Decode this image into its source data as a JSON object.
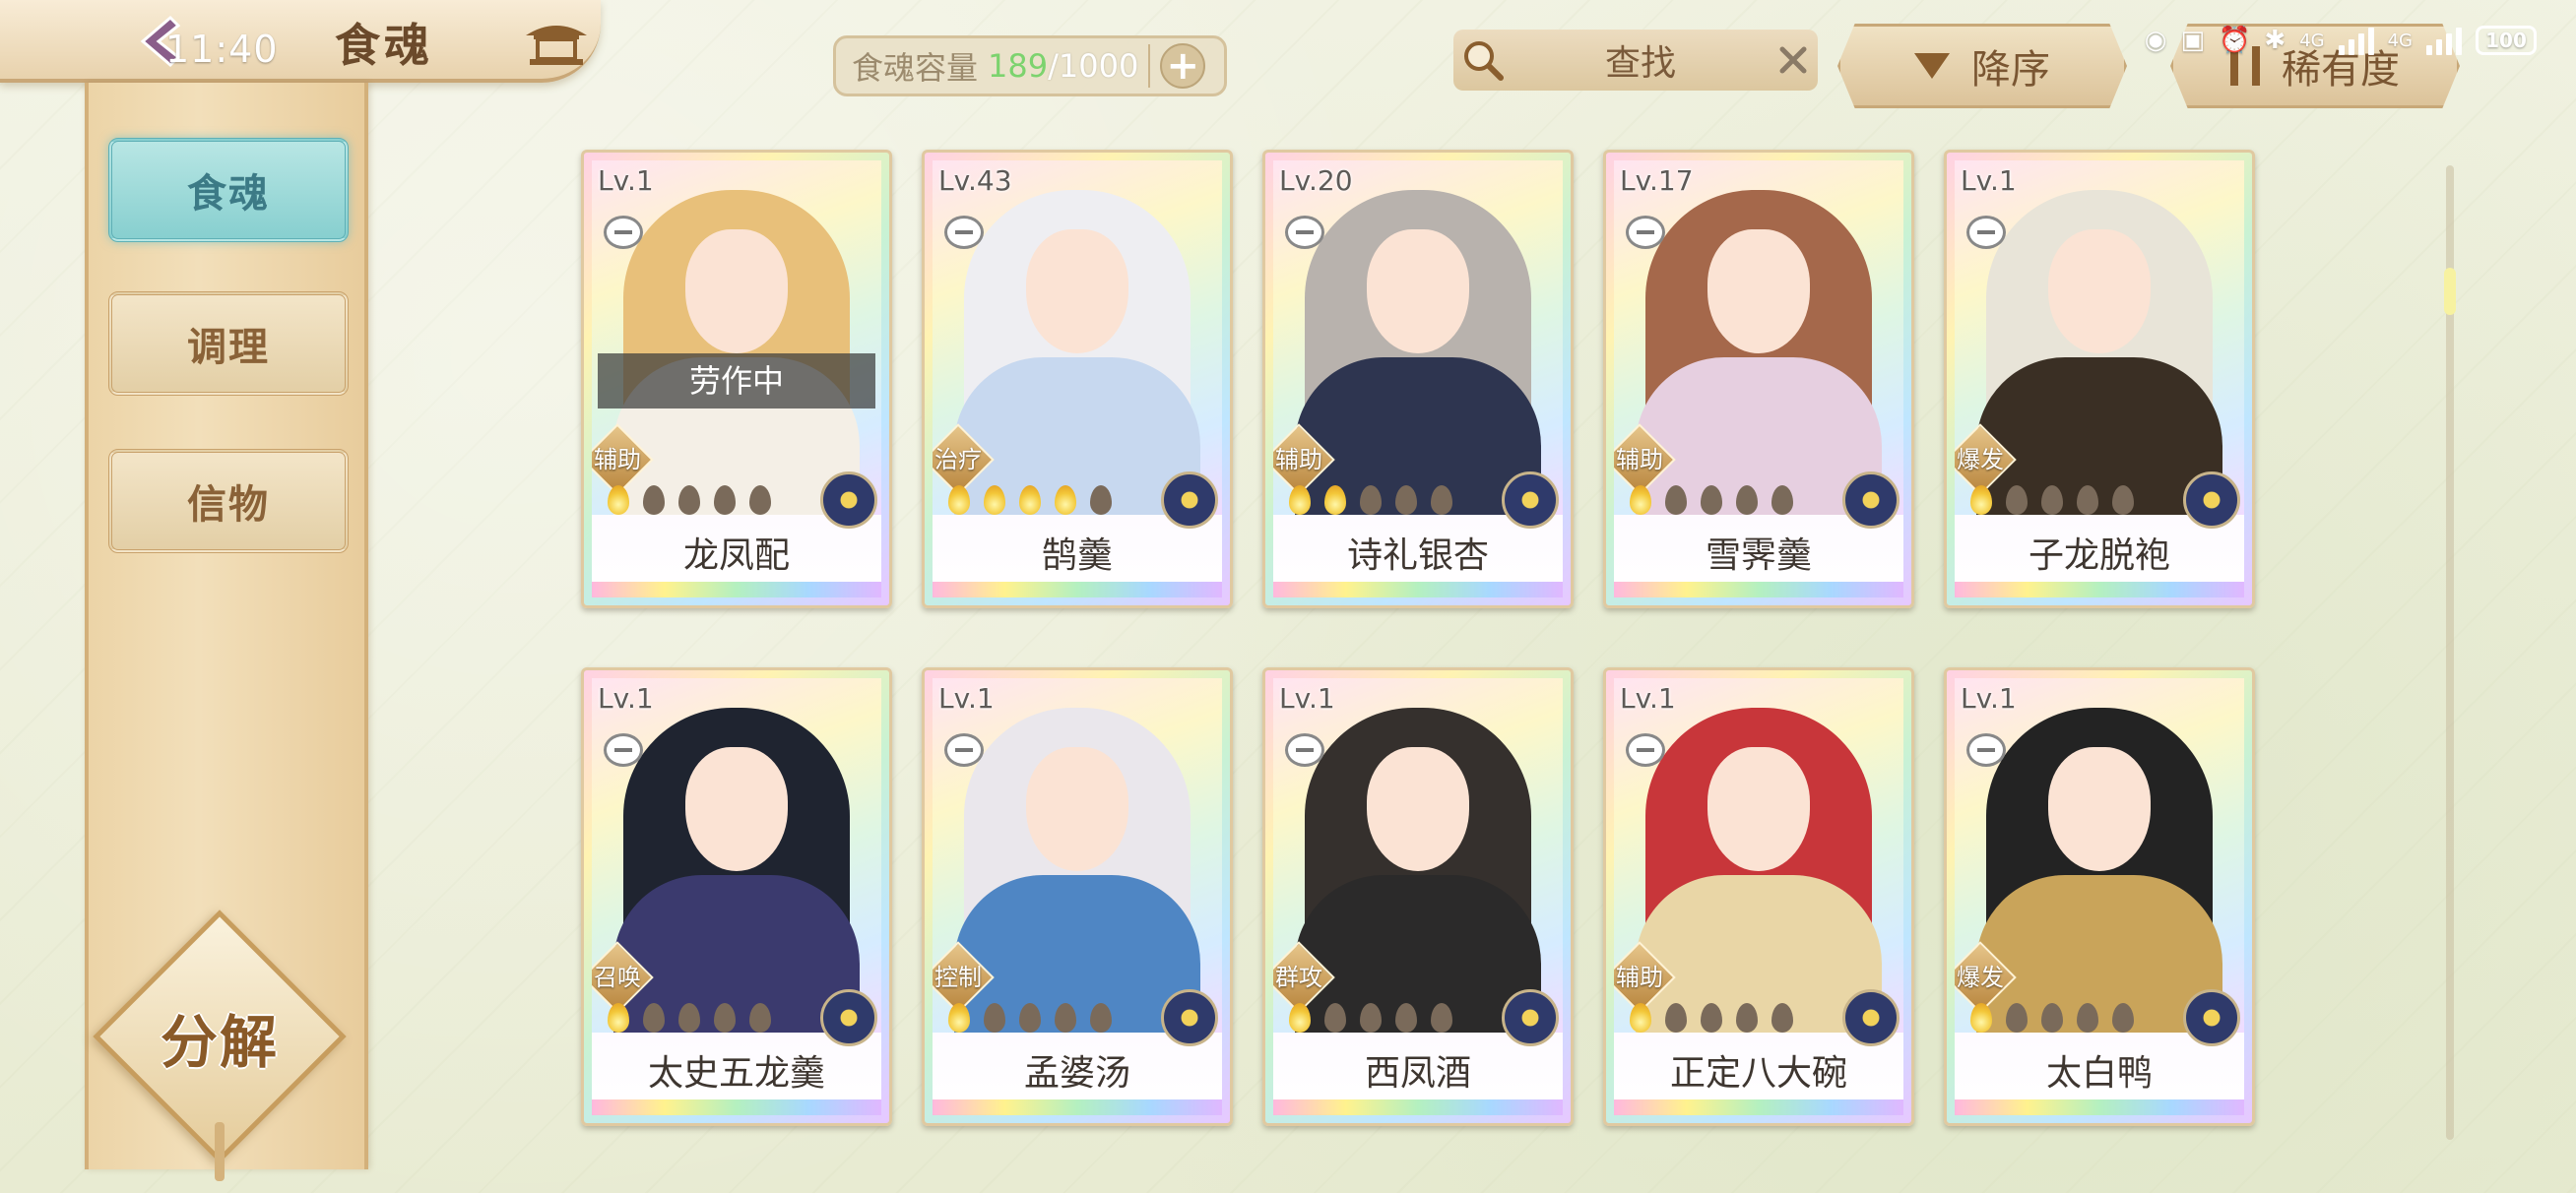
{
  "status_bar": {
    "time": "11:40",
    "network": "4G",
    "network2": "4G",
    "battery": "100"
  },
  "header": {
    "title": "食魂",
    "capacity_label": "食魂容量",
    "capacity_used": "189",
    "capacity_max": "/1000",
    "search_label": "查找",
    "sort_order_label": "降序",
    "sort_rarity_label": "稀有度"
  },
  "sidebar": {
    "tabs": [
      {
        "label": "食魂",
        "active": true
      },
      {
        "label": "调理",
        "active": false
      },
      {
        "label": "信物",
        "active": false
      }
    ],
    "decompose_label": "分解"
  },
  "cards": [
    {
      "level": "Lv.1",
      "role": "辅助",
      "name": "龙凤配",
      "status": "劳作中",
      "stars_lit": 1,
      "stars_total": 5,
      "hair": "#e8c07a",
      "robe": "#f4efe6"
    },
    {
      "level": "Lv.43",
      "role": "治疗",
      "name": "鹄羹",
      "status": "",
      "stars_lit": 4,
      "stars_total": 5,
      "hair": "#eeeef2",
      "robe": "#c7d8ef"
    },
    {
      "level": "Lv.20",
      "role": "辅助",
      "name": "诗礼银杏",
      "status": "",
      "stars_lit": 2,
      "stars_total": 5,
      "hair": "#b8b2ad",
      "robe": "#2e3550"
    },
    {
      "level": "Lv.17",
      "role": "辅助",
      "name": "雪霁羹",
      "status": "",
      "stars_lit": 1,
      "stars_total": 5,
      "hair": "#a5684b",
      "robe": "#e6cfe0"
    },
    {
      "level": "Lv.1",
      "role": "爆发",
      "name": "子龙脱袍",
      "status": "",
      "stars_lit": 1,
      "stars_total": 5,
      "hair": "#e8e4d8",
      "robe": "#3a2f24"
    },
    {
      "level": "Lv.1",
      "role": "召唤",
      "name": "太史五龙羹",
      "status": "",
      "stars_lit": 1,
      "stars_total": 5,
      "hair": "#1f2430",
      "robe": "#3b3a6e"
    },
    {
      "level": "Lv.1",
      "role": "控制",
      "name": "孟婆汤",
      "status": "",
      "stars_lit": 1,
      "stars_total": 5,
      "hair": "#eae7ec",
      "robe": "#4f86c4"
    },
    {
      "level": "Lv.1",
      "role": "群攻",
      "name": "西凤酒",
      "status": "",
      "stars_lit": 1,
      "stars_total": 5,
      "hair": "#35302d",
      "robe": "#2b2a2a"
    },
    {
      "level": "Lv.1",
      "role": "辅助",
      "name": "正定八大碗",
      "status": "",
      "stars_lit": 1,
      "stars_total": 5,
      "hair": "#c8363a",
      "robe": "#e9d6a6"
    },
    {
      "level": "Lv.1",
      "role": "爆发",
      "name": "太白鸭",
      "status": "",
      "stars_lit": 1,
      "stars_total": 5,
      "hair": "#232323",
      "robe": "#c9a45a"
    }
  ]
}
